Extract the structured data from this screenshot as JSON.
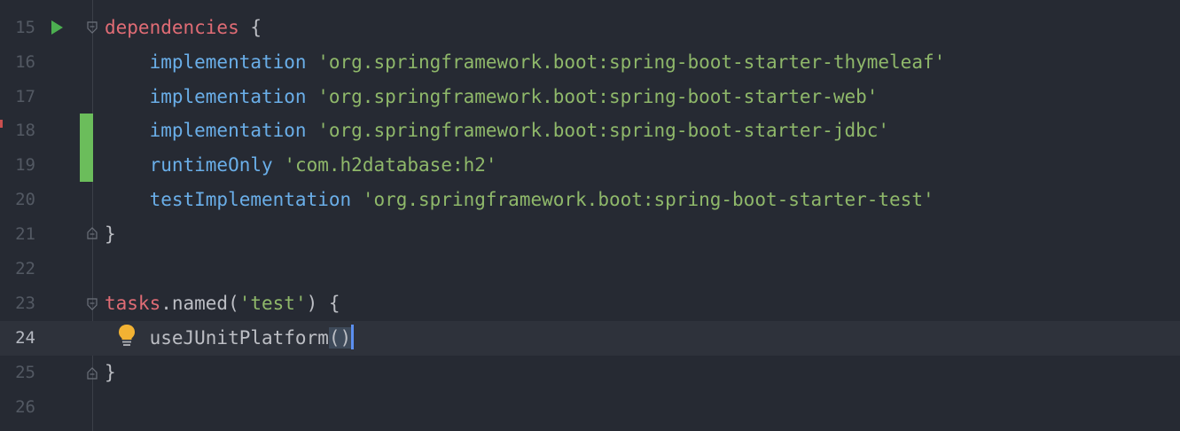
{
  "editor": {
    "lines": [
      {
        "number": "15",
        "tokens": [
          {
            "text": "dependencies",
            "cls": "kw-red"
          },
          {
            "text": " {",
            "cls": "plain"
          }
        ]
      },
      {
        "number": "16",
        "tokens": [
          {
            "text": "    implementation",
            "cls": "fn-blue"
          },
          {
            "text": " ",
            "cls": "plain"
          },
          {
            "text": "'org.springframework.boot:spring-boot-starter-thymeleaf'",
            "cls": "str-green"
          }
        ]
      },
      {
        "number": "17",
        "tokens": [
          {
            "text": "    implementation",
            "cls": "fn-blue"
          },
          {
            "text": " ",
            "cls": "plain"
          },
          {
            "text": "'org.springframework.boot:spring-boot-starter-web'",
            "cls": "str-green"
          }
        ]
      },
      {
        "number": "18",
        "tokens": [
          {
            "text": "    implementation",
            "cls": "fn-blue"
          },
          {
            "text": " ",
            "cls": "plain"
          },
          {
            "text": "'org.springframework.boot:spring-boot-starter-jdbc'",
            "cls": "str-green"
          }
        ]
      },
      {
        "number": "19",
        "tokens": [
          {
            "text": "    runtimeOnly",
            "cls": "fn-blue"
          },
          {
            "text": " ",
            "cls": "plain"
          },
          {
            "text": "'com.h2database:h2'",
            "cls": "str-green"
          }
        ]
      },
      {
        "number": "20",
        "tokens": [
          {
            "text": "    testImplementation",
            "cls": "fn-blue"
          },
          {
            "text": " ",
            "cls": "plain"
          },
          {
            "text": "'org.springframework.boot:spring-boot-starter-test'",
            "cls": "str-green"
          }
        ]
      },
      {
        "number": "21",
        "tokens": [
          {
            "text": "}",
            "cls": "plain"
          }
        ]
      },
      {
        "number": "22",
        "tokens": []
      },
      {
        "number": "23",
        "tokens": [
          {
            "text": "tasks",
            "cls": "kw-red"
          },
          {
            "text": ".named(",
            "cls": "plain"
          },
          {
            "text": "'test'",
            "cls": "str-green"
          },
          {
            "text": ") {",
            "cls": "plain"
          }
        ]
      },
      {
        "number": "24",
        "tokens": [
          {
            "text": "    useJUnitPlatform",
            "cls": "plain"
          },
          {
            "text": "()",
            "cls": "plain paren-hl"
          }
        ],
        "current": true
      },
      {
        "number": "25",
        "tokens": [
          {
            "text": "}",
            "cls": "plain"
          }
        ]
      },
      {
        "number": "26",
        "tokens": []
      }
    ],
    "icons": {
      "run": "run-gutter-icon",
      "fold": "fold-marker-icon",
      "bulb": "lightbulb-icon"
    },
    "colors": {
      "background": "#262a33",
      "current_line": "#2e323b",
      "keyword": "#e06c75",
      "function": "#6aaee8",
      "string": "#8fb86a",
      "change_marker": "#6bbd5b",
      "caret": "#5b8ff0"
    }
  }
}
